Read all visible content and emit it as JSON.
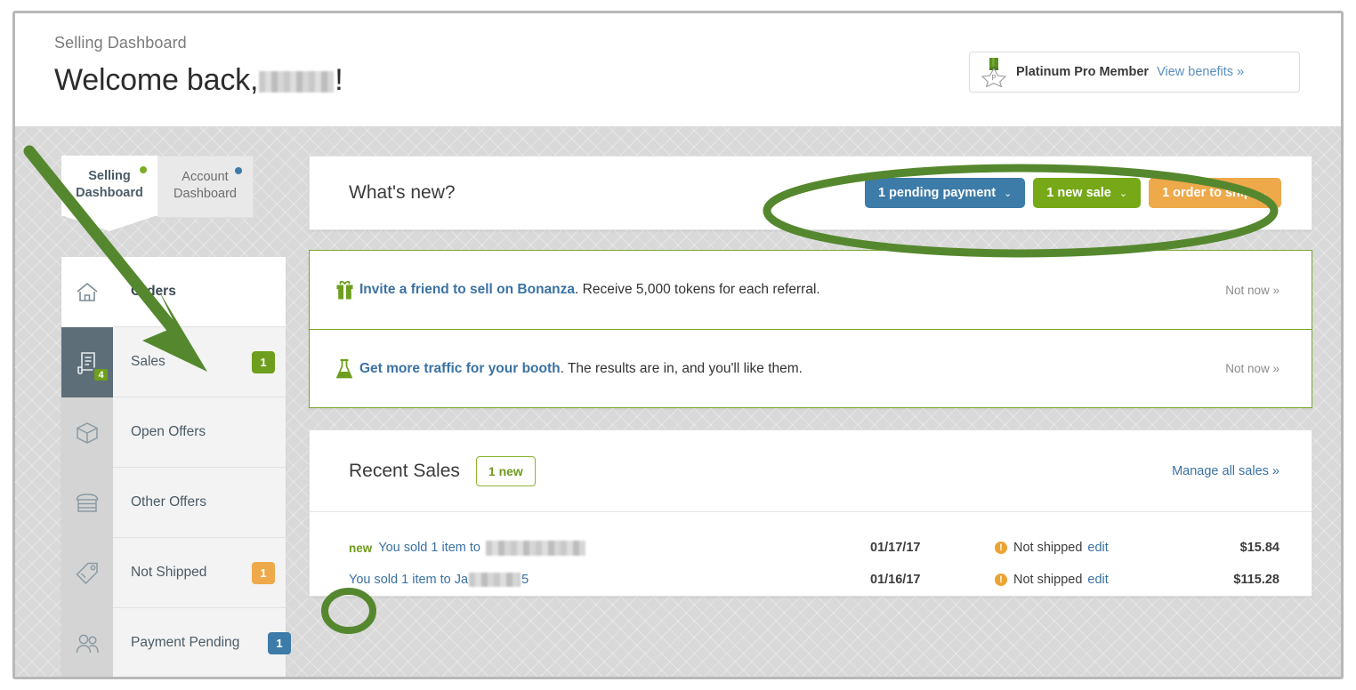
{
  "header": {
    "eyebrow": "Selling Dashboard",
    "welcome_prefix": "Welcome back,",
    "welcome_suffix": "!",
    "membership_label": "Platinum Pro Member",
    "membership_link": "View benefits »",
    "medal_icon": "medal-star-icon"
  },
  "tabs": [
    {
      "line1": "Selling",
      "line2": "Dashboard",
      "dot": "green",
      "active": true
    },
    {
      "line1": "Account",
      "line2": "Dashboard",
      "dot": "blue",
      "active": false
    }
  ],
  "sidebar": {
    "icons": [
      {
        "name": "home-icon",
        "badge": null,
        "state": "plain"
      },
      {
        "name": "invoice-icon",
        "badge": "4",
        "state": "active"
      },
      {
        "name": "package-box-icon",
        "badge": null,
        "state": "plain"
      },
      {
        "name": "storefront-icon",
        "badge": null,
        "state": "plain"
      },
      {
        "name": "price-tag-icon",
        "badge": null,
        "state": "plain"
      },
      {
        "name": "people-icon",
        "badge": null,
        "state": "plain"
      }
    ],
    "items": [
      {
        "label": "Orders",
        "count": null,
        "count_color": "",
        "header": true
      },
      {
        "label": "Sales",
        "count": "1",
        "count_color": "green",
        "header": false
      },
      {
        "label": "Open Offers",
        "count": null,
        "count_color": "",
        "header": false
      },
      {
        "label": "Other Offers",
        "count": null,
        "count_color": "",
        "header": false
      },
      {
        "label": "Not Shipped",
        "count": "1",
        "count_color": "orange",
        "header": false
      },
      {
        "label": "Payment Pending",
        "count": "1",
        "count_color": "blue",
        "header": false
      }
    ]
  },
  "whats_new": {
    "title": "What's new?",
    "caret": "⌄",
    "pills": [
      {
        "label": "1 pending payment",
        "color": "blue",
        "hex": "#3d7ba8"
      },
      {
        "label": "1 new sale",
        "color": "green",
        "hex": "#76a818"
      },
      {
        "label": "1 order to ship",
        "color": "orange",
        "hex": "#eda94a"
      }
    ]
  },
  "promos": [
    {
      "icon": "gift-box-icon",
      "link_text": "Invite a friend to sell on Bonanza",
      "rest_text": ". Receive 5,000 tokens for each referral.",
      "dismiss": "Not now »"
    },
    {
      "icon": "flask-icon",
      "link_text": "Get more traffic for your booth",
      "rest_text": ". The results are in, and you'll like them.",
      "dismiss": "Not now »"
    }
  ],
  "recent_sales": {
    "title": "Recent Sales",
    "new_badge": "1 new",
    "manage_link": "Manage all sales »",
    "rows": [
      {
        "new_tag": "new",
        "desc_prefix": "You sold 1 item to",
        "desc_suffix": "",
        "date": "01/17/17",
        "status": "Not shipped",
        "edit": "edit",
        "amount": "$15.84"
      },
      {
        "new_tag": "",
        "desc_prefix": "You sold 1 item to Ja",
        "desc_suffix": "5",
        "date": "01/16/17",
        "status": "Not shipped",
        "edit": "edit",
        "amount": "$115.28"
      }
    ]
  },
  "annotations": {
    "arrow_color": "#55882e",
    "ellipse_color": "#55882e",
    "items": [
      "arrow-to-sales",
      "ellipse-around-pills",
      "ellipse-around-new-tag"
    ]
  }
}
